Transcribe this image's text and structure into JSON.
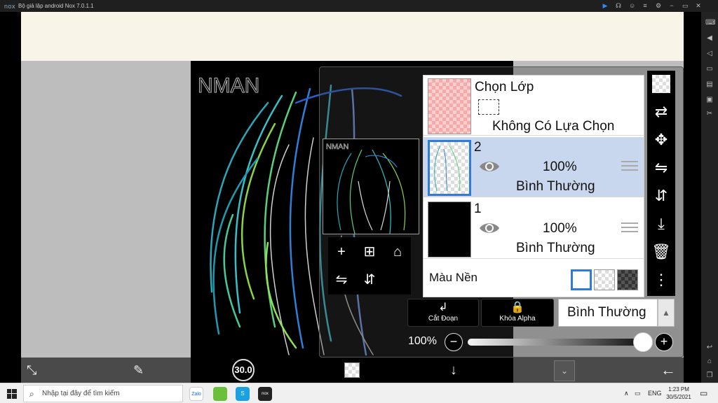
{
  "window": {
    "logo": "nox",
    "title": "Bộ giả lập android Nox 7.0.1.1"
  },
  "layers_panel": {
    "selection_layer": {
      "title": "Chọn Lớp",
      "status": "Không Có Lựa Chọn"
    },
    "layers": [
      {
        "number": "2",
        "opacity": "100%",
        "blend": "Bình Thường",
        "selected": true
      },
      {
        "number": "1",
        "opacity": "100%",
        "blend": "Bình Thường",
        "selected": false
      }
    ],
    "background": {
      "label": "Màu Nền"
    }
  },
  "actions": {
    "clip_label": "Cắt Đoạn",
    "alpha_lock_label": "Khóa Alpha",
    "blend_mode": "Bình Thường"
  },
  "opacity": {
    "value": "100%",
    "minus": "−",
    "plus": "+",
    "level": 1.0
  },
  "toolbar": {
    "brush_size": "30.0"
  },
  "canvas": {
    "signature": "NMAN"
  },
  "taskbar": {
    "search_placeholder": "Nhập tại đây để tìm kiếm",
    "apps": [
      "Zalo",
      "Nox",
      "S",
      "nox"
    ],
    "lang": "ENG",
    "time": "1:23 PM",
    "date": "30/5/2021"
  },
  "colors": {
    "selected_layer_bg": "#c9d7ee",
    "accent_blue": "#2f7bd6"
  }
}
